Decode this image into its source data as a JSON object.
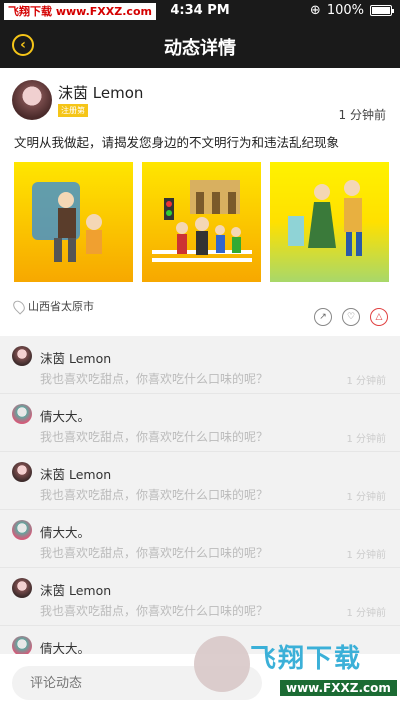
{
  "statusbar": {
    "watermark": "飞翔下载 www.FXXZ.com",
    "time": "4:34 PM",
    "battery": "100%"
  },
  "navbar": {
    "title": "动态详情",
    "back_icon": "back-arrow-icon"
  },
  "post": {
    "author": "沫茵 Lemon",
    "badge": "注册第",
    "time": "1 分钟前",
    "text": "文明从我做起，请揭发您身边的不文明行为和违法乱纪现象",
    "location": "山西省太原市",
    "photos": [
      "photo-1",
      "photo-2",
      "photo-3"
    ]
  },
  "comments": [
    {
      "name": "沫茵 Lemon",
      "text": "我也喜欢吃甜点，你喜欢吃什么口味的呢？",
      "time": "1 分钟前"
    },
    {
      "name": "倩大大。",
      "text": "我也喜欢吃甜点，你喜欢吃什么口味的呢？",
      "time": "1 分钟前"
    },
    {
      "name": "沫茵 Lemon",
      "text": "我也喜欢吃甜点，你喜欢吃什么口味的呢？",
      "time": "1 分钟前"
    },
    {
      "name": "倩大大。",
      "text": "我也喜欢吃甜点，你喜欢吃什么口味的呢？",
      "time": "1 分钟前"
    },
    {
      "name": "沫茵 Lemon",
      "text": "我也喜欢吃甜点，你喜欢吃什么口味的呢？",
      "time": "1 分钟前"
    },
    {
      "name": "倩大大。",
      "text": "",
      "time": ""
    }
  ],
  "bottombar": {
    "input_placeholder": "评论动态"
  },
  "watermark": {
    "title": "飞翔下载",
    "url": "www.FXXZ.com"
  }
}
